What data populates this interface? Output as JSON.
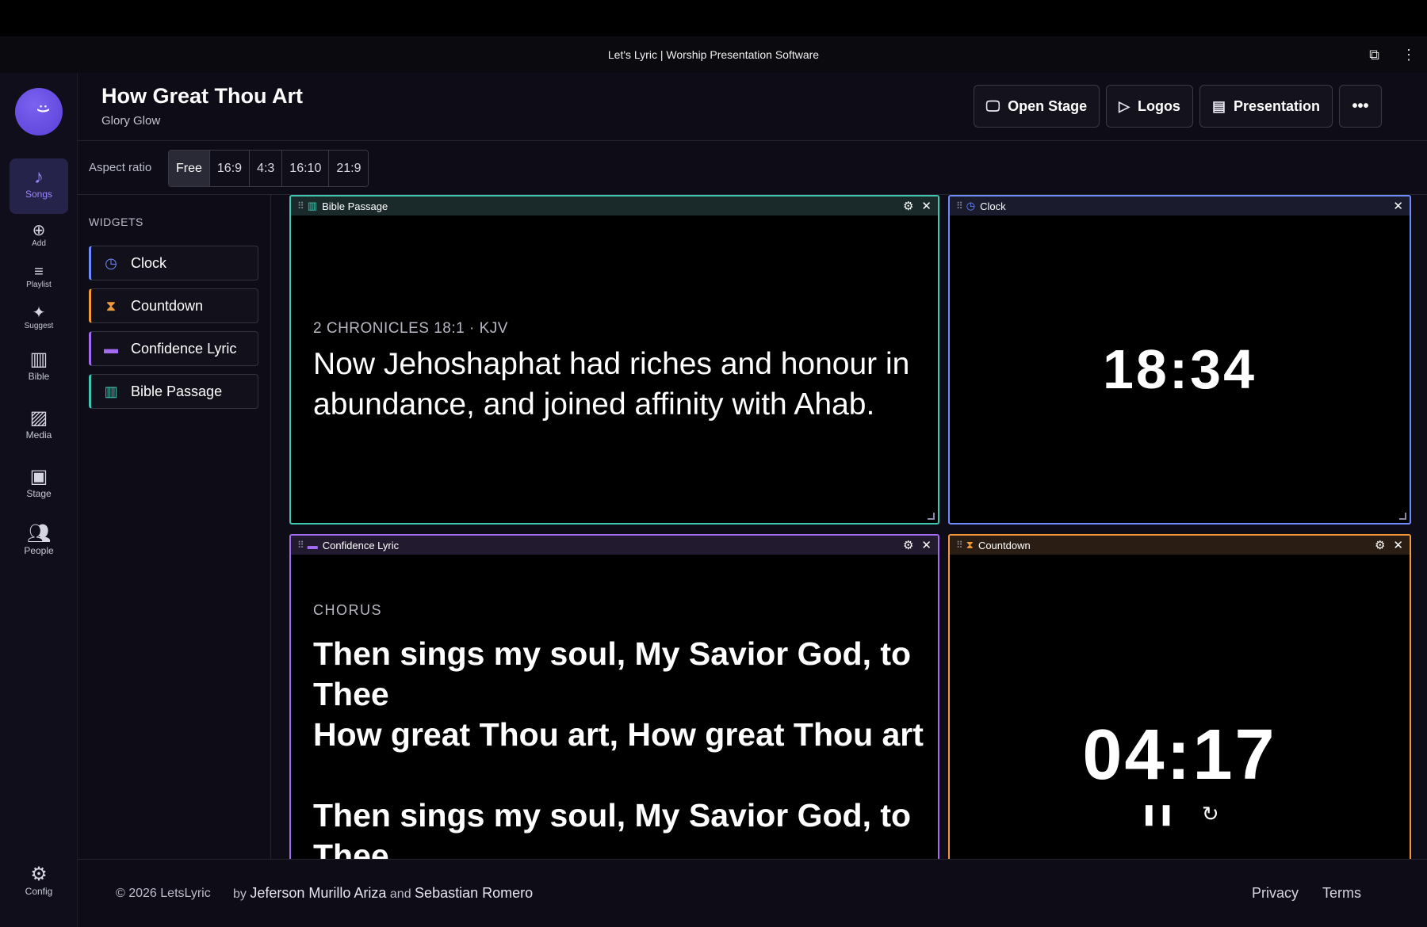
{
  "window": {
    "title": "Let's Lyric | Worship Presentation Software",
    "icons": [
      "extension-icon",
      "more-vertical-icon"
    ]
  },
  "sidebar": {
    "items": [
      {
        "label": "Songs",
        "icon": "music-note-icon",
        "active": true
      },
      {
        "label": "Add",
        "icon": "add-circle-icon"
      },
      {
        "label": "Playlist",
        "icon": "playlist-icon"
      },
      {
        "label": "Suggest",
        "icon": "sparkles-icon"
      },
      {
        "label": "Bible",
        "icon": "book-icon"
      },
      {
        "label": "Media",
        "icon": "images-icon"
      },
      {
        "label": "Stage",
        "icon": "tv-icon"
      },
      {
        "label": "People",
        "icon": "people-icon"
      },
      {
        "label": "Config",
        "icon": "gear-icon"
      }
    ]
  },
  "header": {
    "title": "How Great Thou Art",
    "subtitle": "Glory Glow",
    "buttons": {
      "open_stage": "Open Stage",
      "logos": "Logos",
      "presentation": "Presentation"
    }
  },
  "aspect": {
    "label": "Aspect ratio",
    "options": [
      "Free",
      "16:9",
      "4:3",
      "16:10",
      "21:9"
    ],
    "selected": "Free"
  },
  "widgets_panel": {
    "title": "WIDGETS",
    "items": [
      {
        "label": "Clock",
        "icon": "clock-icon",
        "color": "#6f8cff"
      },
      {
        "label": "Countdown",
        "icon": "hourglass-icon",
        "color": "#f29a3a"
      },
      {
        "label": "Confidence Lyric",
        "icon": "subtitles-icon",
        "color": "#a36cf0"
      },
      {
        "label": "Bible Passage",
        "icon": "open-book-icon",
        "color": "#3fc7b0"
      }
    ]
  },
  "canvas": {
    "bible": {
      "title": "Bible Passage",
      "reference": "2 CHRONICLES 18:1 · KJV",
      "text": "Now Jehoshaphat had riches and honour in abundance, and joined affinity with Ahab.",
      "border_color": "#3fc7b0"
    },
    "clock": {
      "title": "Clock",
      "time": "18:34",
      "border_color": "#6f8cff"
    },
    "lyric": {
      "title": "Confidence Lyric",
      "section": "CHORUS",
      "lines": [
        "Then sings my soul, My Savior God, to Thee",
        "How great Thou art, How great Thou art",
        "Then sings my soul, My Savior God, to Thee"
      ],
      "border_color": "#a36cf0"
    },
    "countdown": {
      "title": "Countdown",
      "time": "04:17",
      "border_color": "#f29a3a"
    }
  },
  "footer": {
    "copyright": "© 2026 LetsLyric",
    "by": "by",
    "author1": "Jeferson Murillo Ariza",
    "and": "and",
    "author2": "Sebastian Romero",
    "links": [
      "Privacy",
      "Terms"
    ]
  }
}
